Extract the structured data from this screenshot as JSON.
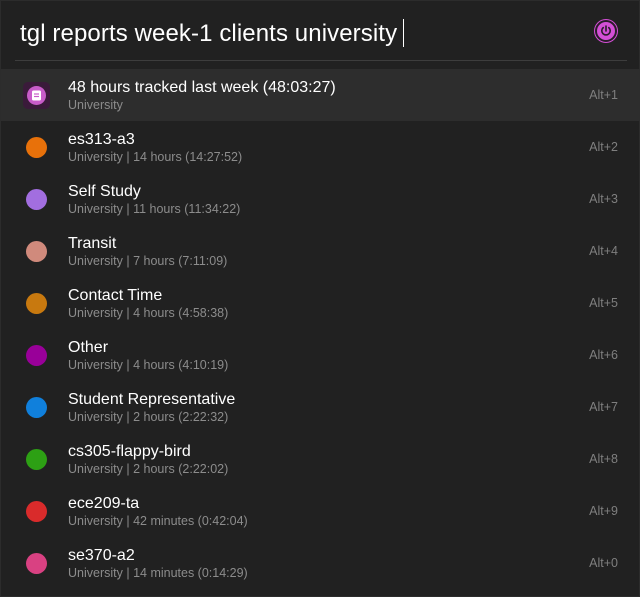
{
  "search": {
    "query": "tgl reports week-1 clients university"
  },
  "app_icon": {
    "icon": "power-icon",
    "color": "#d44fd6"
  },
  "results": [
    {
      "title": "48 hours tracked last week (48:03:27)",
      "subtitle": "University",
      "shortcut": "Alt+1",
      "icon": "report-icon",
      "color": "#c85cc9",
      "selected": true
    },
    {
      "title": "es313-a3",
      "subtitle": "University | 14 hours (14:27:52)",
      "shortcut": "Alt+2",
      "icon": "project-color-dot",
      "color": "#e8710a"
    },
    {
      "title": "Self Study",
      "subtitle": "University | 11 hours (11:34:22)",
      "shortcut": "Alt+3",
      "icon": "project-color-dot",
      "color": "#a26ee0"
    },
    {
      "title": "Transit",
      "subtitle": "University | 7 hours (7:11:09)",
      "shortcut": "Alt+4",
      "icon": "project-color-dot",
      "color": "#d08a7c"
    },
    {
      "title": "Contact Time",
      "subtitle": "University | 4 hours (4:58:38)",
      "shortcut": "Alt+5",
      "icon": "project-color-dot",
      "color": "#c8790f"
    },
    {
      "title": "Other",
      "subtitle": "University | 4 hours (4:10:19)",
      "shortcut": "Alt+6",
      "icon": "project-color-dot",
      "color": "#990099"
    },
    {
      "title": "Student Representative",
      "subtitle": "University | 2 hours (2:22:32)",
      "shortcut": "Alt+7",
      "icon": "project-color-dot",
      "color": "#1080dc"
    },
    {
      "title": "cs305-flappy-bird",
      "subtitle": "University | 2 hours (2:22:02)",
      "shortcut": "Alt+8",
      "icon": "project-color-dot",
      "color": "#2da014"
    },
    {
      "title": "ece209-ta",
      "subtitle": "University | 42 minutes (0:42:04)",
      "shortcut": "Alt+9",
      "icon": "project-color-dot",
      "color": "#d92b2b"
    },
    {
      "title": "se370-a2",
      "subtitle": "University | 14 minutes (0:14:29)",
      "shortcut": "Alt+0",
      "icon": "project-color-dot",
      "color": "#d94182"
    }
  ]
}
